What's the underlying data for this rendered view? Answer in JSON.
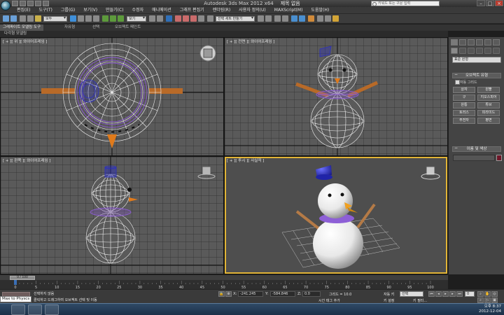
{
  "window": {
    "app_title": "Autodesk 3ds Max  2012 x64",
    "doc_title": "제목 없음",
    "search_placeholder": "키워드 또는 구문 입력",
    "minimize": "–",
    "maximize": "□",
    "close": "×"
  },
  "menu": {
    "items": [
      "편집(E)",
      "도구(T)",
      "그룹(G)",
      "보기(V)",
      "만들기(C)",
      "수정자",
      "애니메이션",
      "그래프 편집기",
      "렌더링(R)",
      "사용자 정의(U)",
      "MAXScript(M)",
      "도움말(H)"
    ]
  },
  "toolbar": {
    "selection_filter": "모두",
    "view_dropdown": "보기",
    "named_selection": "선택 세트 만들기"
  },
  "ribbon": {
    "tabs": [
      "그래파이트 모델링 도구",
      "자유형",
      "선택",
      "오브젝트 페인트"
    ],
    "sub_label": "다각형 모델링"
  },
  "viewports": {
    "top_label": "[ + ][ 위 ][ 와이어프레임 ]",
    "front_label": "[ + ][ 전면 ][ 와이어프레임 ]",
    "left_label": "[ + ][ 왼쪽 ][ 와이어프레임 ]",
    "persp_label": "[ + ][ 투시 ][ 사실적 ]"
  },
  "command_panel": {
    "category": "표준 원형",
    "object_type_header": "오브젝트 유형",
    "autogrid": "자동 그리드",
    "buttons": [
      "상자",
      "원뿔",
      "구",
      "지오스피어",
      "원통",
      "튜브",
      "토러스",
      "피라미드",
      "주전자",
      "평면"
    ],
    "name_color_header": "이름 및 색상"
  },
  "timeline": {
    "frame_display": "0 / 100",
    "ticks": [
      "0",
      "5",
      "10",
      "15",
      "20",
      "25",
      "30",
      "35",
      "40",
      "45",
      "50",
      "55",
      "60",
      "65",
      "70",
      "75",
      "80",
      "85",
      "90",
      "95",
      "100"
    ]
  },
  "status": {
    "selection_info": "선택하지 않음",
    "prompt": "클릭하고 드래그하여 오브젝트 선택 및 이동",
    "x_label": "X:",
    "x_value": "-241.245",
    "y_label": "Y:",
    "y_value": "-584.846",
    "z_label": "Z:",
    "z_value": "0.0",
    "grid": "그리드 = 10.0",
    "auto_key": "자동 키",
    "selected_dropdown": "선택",
    "set_key": "키 설정",
    "key_filters": "키 필터...",
    "add_time_tag": "시간 태그 추가",
    "frame_field": "0"
  },
  "taskbar": {
    "tooltip": "Max to Physcs",
    "clock_time": "오후 8:37",
    "clock_date": "2012-12-04"
  },
  "colors": {
    "viewport_bg": "#5a5a5a",
    "active_border": "#e1b437",
    "wire": "#ffffff",
    "scarf": "#8e5cd6",
    "hat": "#2b2fc2",
    "arms": "#b86a28",
    "nose": "#e07a1b"
  }
}
